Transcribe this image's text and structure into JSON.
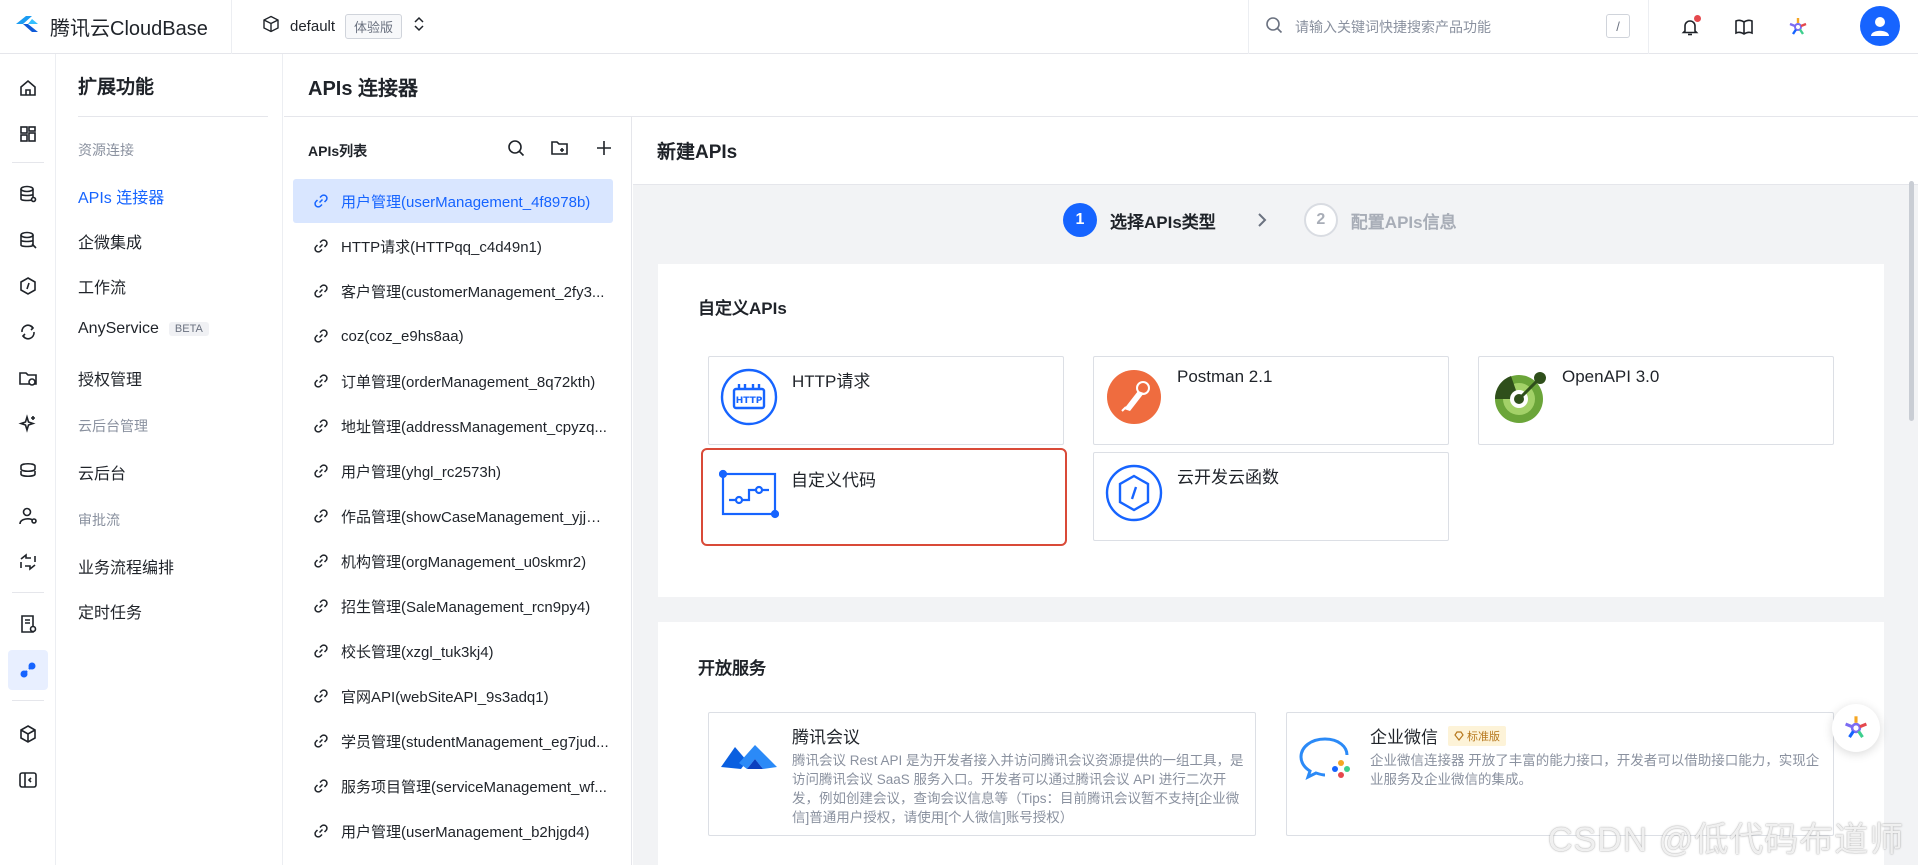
{
  "topbar": {
    "brand": "腾讯云CloudBase",
    "env_name": "default",
    "env_tag": "体验版",
    "search_placeholder": "请输入关键词快捷搜索产品功能",
    "search_shortcut": "/"
  },
  "sidebar": {
    "title": "扩展功能",
    "group_resource": "资源连接",
    "item_apis": "APIs 连接器",
    "item_wecom": "企微集成",
    "item_workflow": "工作流",
    "item_anyservice": "AnyService",
    "beta": "BETA",
    "item_auth": "授权管理",
    "group_backend": "云后台管理",
    "item_backend": "云后台",
    "group_approval": "审批流",
    "item_process": "业务流程编排",
    "item_cron": "定时任务"
  },
  "main": {
    "title": "APIs 连接器"
  },
  "apilist": {
    "title": "APIs列表",
    "items": [
      "用户管理(userManagement_4f8978b)",
      "HTTP请求(HTTPqq_c4d49n1)",
      "客户管理(customerManagement_2fy3...",
      "coz(coz_e9hs8aa)",
      "订单管理(orderManagement_8q72kth)",
      "地址管理(addressManagement_cpyzq...",
      "用户管理(yhgl_rc2573h)",
      "作品管理(showCaseManagement_yjjm...",
      "机构管理(orgManagement_u0skmr2)",
      "招生管理(SaleManagement_rcn9py4)",
      "校长管理(xzgl_tuk3kj4)",
      "官网API(webSiteAPI_9s3adq1)",
      "学员管理(studentManagement_eg7jud...",
      "服务项目管理(serviceManagement_wf...",
      "用户管理(userManagement_b2hjgd4)"
    ]
  },
  "content": {
    "title": "新建APIs",
    "step1_num": "1",
    "step1_label": "选择APIs类型",
    "step2_num": "2",
    "step2_label": "配置APIs信息",
    "custom_title": "自定义APIs",
    "card_http": "HTTP请求",
    "card_postman": "Postman 2.1",
    "card_openapi": "OpenAPI 3.0",
    "card_custom_code": "自定义代码",
    "card_cloud_fn": "云开发云函数",
    "open_title": "开放服务",
    "svc_meeting_name": "腾讯会议",
    "svc_meeting_desc": "腾讯会议 Rest API 是为开发者接入并访问腾讯会议资源提供的一组工具，是访问腾讯会议 SaaS 服务入口。开发者可以通过腾讯会议 API 进行二次开发，例如创建会议，查询会议信息等（Tips：目前腾讯会议暂不支持[企业微信]普通用户授权，请使用[个人微信]账号授权）",
    "svc_wecom_name": "企业微信",
    "svc_wecom_badge": "标准版",
    "svc_wecom_desc": "企业微信连接器 开放了丰富的能力接口，开发者可以借助接口能力，实现企业服务及企业微信的集成。"
  },
  "watermark": "CSDN @低代码布道师",
  "colors": {
    "primary": "#1664ff",
    "selected_border": "#d94a38",
    "postman": "#ef6c3f",
    "openapi": "#6ba539"
  }
}
